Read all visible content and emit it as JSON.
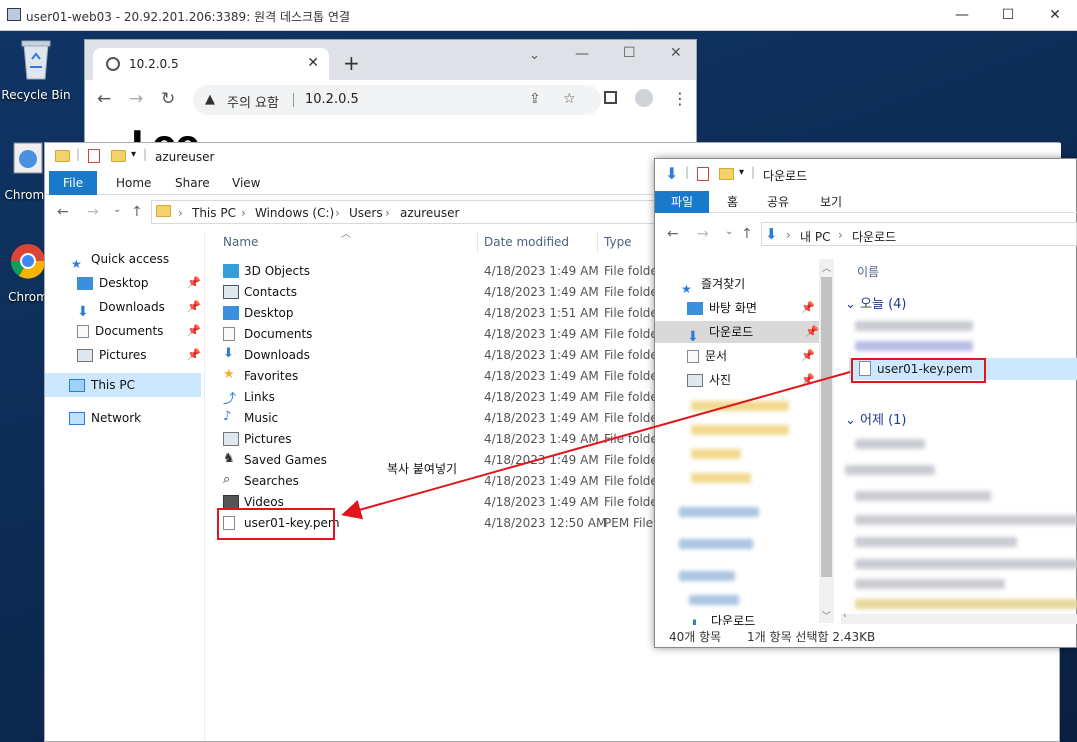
{
  "rdp": {
    "title": "user01-web03 - 20.92.201.206:3389: 원격 데스크톱 연결",
    "min": "—",
    "max": "☐",
    "close": "✕"
  },
  "desktop": {
    "icons": [
      {
        "label": "Recycle Bin"
      },
      {
        "label": "Chrome"
      },
      {
        "label": "Chrom"
      }
    ]
  },
  "chrome": {
    "tab_title": "10.2.0.5",
    "warning": "주의 요함",
    "url": "10.2.0.5",
    "page_text": "Loo"
  },
  "explorer": {
    "qat_title": "azureuser",
    "tabs": [
      "File",
      "Home",
      "Share",
      "View"
    ],
    "crumbs": [
      "This PC",
      "Windows (C:)",
      "Users",
      "azureuser"
    ],
    "nav": {
      "quick_access": "Quick access",
      "items": [
        "Desktop",
        "Downloads",
        "Documents",
        "Pictures"
      ],
      "this_pc": "This PC",
      "network": "Network"
    },
    "columns": {
      "name": "Name",
      "date": "Date modified",
      "type": "Type"
    },
    "files": [
      {
        "name": "3D Objects",
        "date": "4/18/2023 1:49 AM",
        "type": "File folder",
        "icon": "3d-objects-icon"
      },
      {
        "name": "Contacts",
        "date": "4/18/2023 1:49 AM",
        "type": "File folder",
        "icon": "contacts-icon"
      },
      {
        "name": "Desktop",
        "date": "4/18/2023 1:51 AM",
        "type": "File folder",
        "icon": "desktop-folder-icon"
      },
      {
        "name": "Documents",
        "date": "4/18/2023 1:49 AM",
        "type": "File folder",
        "icon": "documents-icon"
      },
      {
        "name": "Downloads",
        "date": "4/18/2023 1:49 AM",
        "type": "File folder",
        "icon": "downloads-icon"
      },
      {
        "name": "Favorites",
        "date": "4/18/2023 1:49 AM",
        "type": "File folder",
        "icon": "favorites-star-icon"
      },
      {
        "name": "Links",
        "date": "4/18/2023 1:49 AM",
        "type": "File folder",
        "icon": "links-icon"
      },
      {
        "name": "Music",
        "date": "4/18/2023 1:49 AM",
        "type": "File folder",
        "icon": "music-note-icon"
      },
      {
        "name": "Pictures",
        "date": "4/18/2023 1:49 AM",
        "type": "File folder",
        "icon": "pictures-icon"
      },
      {
        "name": "Saved Games",
        "date": "4/18/2023 1:49 AM",
        "type": "File folder",
        "icon": "saved-games-icon"
      },
      {
        "name": "Searches",
        "date": "4/18/2023 1:49 AM",
        "type": "File folder",
        "icon": "search-icon"
      },
      {
        "name": "Videos",
        "date": "4/18/2023 1:49 AM",
        "type": "File folder",
        "icon": "videos-icon"
      },
      {
        "name": "user01-key.pem",
        "date": "4/18/2023 12:50 AM",
        "type": "PEM File",
        "icon": "file-icon"
      }
    ]
  },
  "annotation": {
    "label": "복사 붙여넣기"
  },
  "downloads": {
    "title": "다운로드",
    "tabs": [
      "파일",
      "홈",
      "공유",
      "보기"
    ],
    "crumbs": [
      "내 PC",
      "다운로드"
    ],
    "nav": {
      "quick": "즐겨찾기",
      "items": [
        "바탕 화면",
        "다운로드",
        "문서",
        "사진"
      ],
      "bottom": "다운로드"
    },
    "column_name": "이름",
    "group_today": "오늘 (4)",
    "group_yesterday": "어제 (1)",
    "selected_file": "user01-key.pem",
    "status_count": "40개 항목",
    "status_selected": "1개 항목 선택함 2.43KB"
  }
}
